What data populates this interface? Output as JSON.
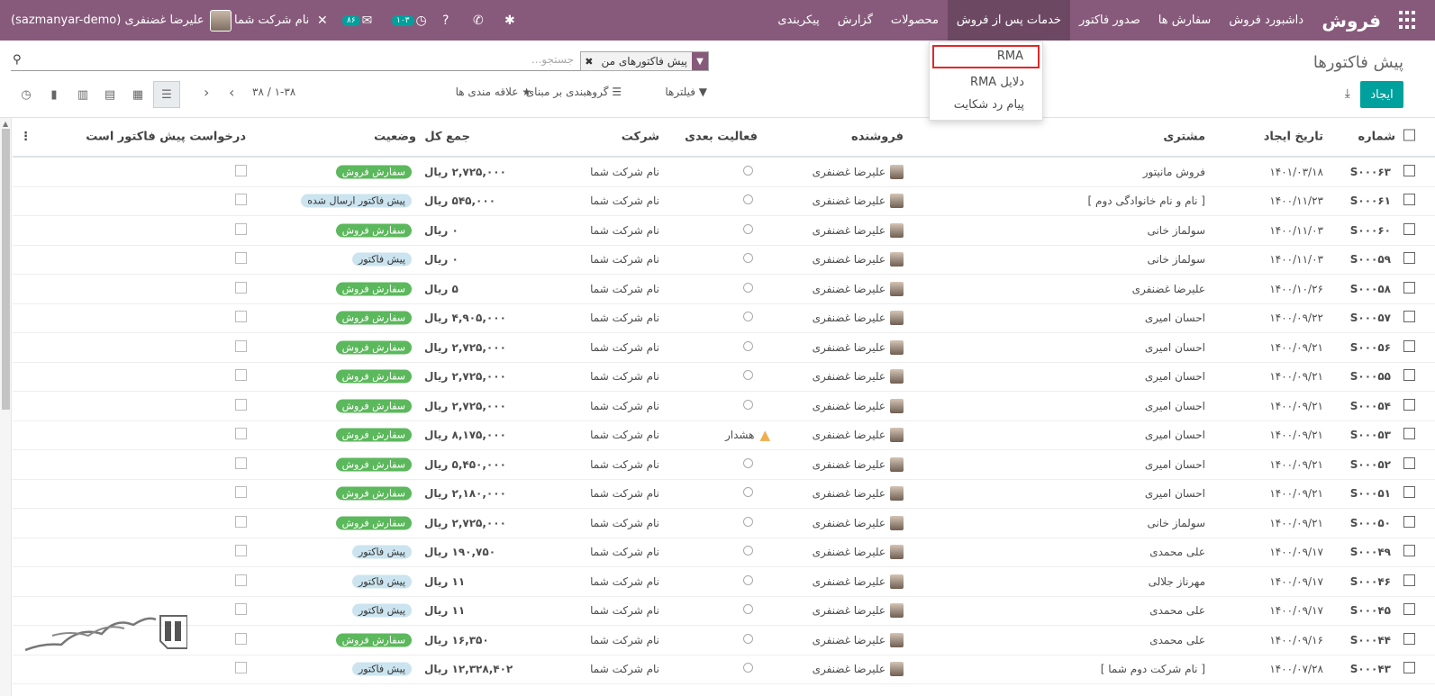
{
  "topbar": {
    "app_title": "فروش",
    "menu": [
      "داشبورد فروش",
      "سفارش ها",
      "صدور فاکتور",
      "خدمات پس از فروش",
      "محصولات",
      "گزارش",
      "پیکربندی"
    ],
    "company": "نام شرکت شما",
    "user": "علیرضا غضنفری (sazmanyar-demo)",
    "badge_activities": "۱۰۳",
    "badge_messages": "۸۶"
  },
  "dropdown": {
    "items": [
      "RMA",
      "دلایل RMA",
      "پیام رد شکایت"
    ]
  },
  "control": {
    "breadcrumb": "پیش فاکتورها",
    "facet": "پیش فاکتورهای من",
    "search_placeholder": "جستجو...",
    "create": "ایجاد",
    "filters": "فیلترها",
    "groupby": "گروهبندی بر مبنای",
    "favorites": "علاقه مندی ها",
    "pager": "۱-۳۸ / ۳۸"
  },
  "colors": {
    "brand": "#875a7b",
    "accent": "#00a09d",
    "sale_order": "#5cb85c",
    "quotation": "#cbe4ef"
  },
  "table": {
    "headers": {
      "number": "شماره",
      "date": "تاریخ ایجاد",
      "customer": "مشتری",
      "salesperson": "فروشنده",
      "activity": "فعالیت بعدی",
      "company": "شرکت",
      "total": "جمع کل",
      "status": "وضعیت",
      "request": "درخواست پیش فاکتور است"
    },
    "rows": [
      {
        "number": "S۰۰۰۶۳",
        "date": "۱۴۰۱/۰۳/۱۸",
        "customer": "فروش مانیتور",
        "salesperson": "علیرضا غضنفری",
        "activity": "",
        "company": "نام شرکت شما",
        "total": "۲,۷۲۵,۰۰۰ ریال",
        "status": "سفارش فروش",
        "status_type": "sale"
      },
      {
        "number": "S۰۰۰۶۱",
        "date": "۱۴۰۰/۱۱/۲۳",
        "customer": "[ نام و نام خانوادگی دوم ]",
        "salesperson": "علیرضا غضنفری",
        "activity": "",
        "company": "نام شرکت شما",
        "total": "۵۴۵,۰۰۰ ریال",
        "status": "پیش فاکتور ارسال شده",
        "status_type": "quote"
      },
      {
        "number": "S۰۰۰۶۰",
        "date": "۱۴۰۰/۱۱/۰۳",
        "customer": "سولماز خانی",
        "salesperson": "علیرضا غضنفری",
        "activity": "",
        "company": "نام شرکت شما",
        "total": "۰ ریال",
        "status": "سفارش فروش",
        "status_type": "sale"
      },
      {
        "number": "S۰۰۰۵۹",
        "date": "۱۴۰۰/۱۱/۰۳",
        "customer": "سولماز خانی",
        "salesperson": "علیرضا غضنفری",
        "activity": "",
        "company": "نام شرکت شما",
        "total": "۰ ریال",
        "status": "پیش فاکتور",
        "status_type": "quote"
      },
      {
        "number": "S۰۰۰۵۸",
        "date": "۱۴۰۰/۱۰/۲۶",
        "customer": "علیرضا غضنفری",
        "salesperson": "علیرضا غضنفری",
        "activity": "",
        "company": "نام شرکت شما",
        "total": "۵ ریال",
        "status": "سفارش فروش",
        "status_type": "sale"
      },
      {
        "number": "S۰۰۰۵۷",
        "date": "۱۴۰۰/۰۹/۲۲",
        "customer": "احسان امیری",
        "salesperson": "علیرضا غضنفری",
        "activity": "",
        "company": "نام شرکت شما",
        "total": "۴,۹۰۵,۰۰۰ ریال",
        "status": "سفارش فروش",
        "status_type": "sale"
      },
      {
        "number": "S۰۰۰۵۶",
        "date": "۱۴۰۰/۰۹/۲۱",
        "customer": "احسان امیری",
        "salesperson": "علیرضا غضنفری",
        "activity": "",
        "company": "نام شرکت شما",
        "total": "۲,۷۲۵,۰۰۰ ریال",
        "status": "سفارش فروش",
        "status_type": "sale"
      },
      {
        "number": "S۰۰۰۵۵",
        "date": "۱۴۰۰/۰۹/۲۱",
        "customer": "احسان امیری",
        "salesperson": "علیرضا غضنفری",
        "activity": "",
        "company": "نام شرکت شما",
        "total": "۲,۷۲۵,۰۰۰ ریال",
        "status": "سفارش فروش",
        "status_type": "sale"
      },
      {
        "number": "S۰۰۰۵۴",
        "date": "۱۴۰۰/۰۹/۲۱",
        "customer": "احسان امیری",
        "salesperson": "علیرضا غضنفری",
        "activity": "",
        "company": "نام شرکت شما",
        "total": "۲,۷۲۵,۰۰۰ ریال",
        "status": "سفارش فروش",
        "status_type": "sale"
      },
      {
        "number": "S۰۰۰۵۳",
        "date": "۱۴۰۰/۰۹/۲۱",
        "customer": "احسان امیری",
        "salesperson": "علیرضا غضنفری",
        "activity": "هشدار",
        "company": "نام شرکت شما",
        "total": "۸,۱۷۵,۰۰۰ ریال",
        "status": "سفارش فروش",
        "status_type": "sale"
      },
      {
        "number": "S۰۰۰۵۲",
        "date": "۱۴۰۰/۰۹/۲۱",
        "customer": "احسان امیری",
        "salesperson": "علیرضا غضنفری",
        "activity": "",
        "company": "نام شرکت شما",
        "total": "۵,۴۵۰,۰۰۰ ریال",
        "status": "سفارش فروش",
        "status_type": "sale"
      },
      {
        "number": "S۰۰۰۵۱",
        "date": "۱۴۰۰/۰۹/۲۱",
        "customer": "احسان امیری",
        "salesperson": "علیرضا غضنفری",
        "activity": "",
        "company": "نام شرکت شما",
        "total": "۲,۱۸۰,۰۰۰ ریال",
        "status": "سفارش فروش",
        "status_type": "sale"
      },
      {
        "number": "S۰۰۰۵۰",
        "date": "۱۴۰۰/۰۹/۲۱",
        "customer": "سولماز خانی",
        "salesperson": "علیرضا غضنفری",
        "activity": "",
        "company": "نام شرکت شما",
        "total": "۲,۷۲۵,۰۰۰ ریال",
        "status": "سفارش فروش",
        "status_type": "sale"
      },
      {
        "number": "S۰۰۰۴۹",
        "date": "۱۴۰۰/۰۹/۱۷",
        "customer": "علی محمدی",
        "salesperson": "علیرضا غضنفری",
        "activity": "",
        "company": "نام شرکت شما",
        "total": "۱۹۰,۷۵۰ ریال",
        "status": "پیش فاکتور",
        "status_type": "quote"
      },
      {
        "number": "S۰۰۰۴۶",
        "date": "۱۴۰۰/۰۹/۱۷",
        "customer": "مهرناز جلالی",
        "salesperson": "علیرضا غضنفری",
        "activity": "",
        "company": "نام شرکت شما",
        "total": "۱۱ ریال",
        "status": "پیش فاکتور",
        "status_type": "quote"
      },
      {
        "number": "S۰۰۰۴۵",
        "date": "۱۴۰۰/۰۹/۱۷",
        "customer": "علی محمدی",
        "salesperson": "علیرضا غضنفری",
        "activity": "",
        "company": "نام شرکت شما",
        "total": "۱۱ ریال",
        "status": "پیش فاکتور",
        "status_type": "quote"
      },
      {
        "number": "S۰۰۰۴۴",
        "date": "۱۴۰۰/۰۹/۱۶",
        "customer": "علی محمدی",
        "salesperson": "علیرضا غضنفری",
        "activity": "",
        "company": "نام شرکت شما",
        "total": "۱۶,۳۵۰ ریال",
        "status": "سفارش فروش",
        "status_type": "sale"
      },
      {
        "number": "S۰۰۰۴۳",
        "date": "۱۴۰۰/۰۷/۲۸",
        "customer": "[ نام شرکت دوم شما ]",
        "salesperson": "علیرضا غضنفری",
        "activity": "",
        "company": "نام شرکت شما",
        "total": "۱۲,۳۲۸,۴۰۲ ریال",
        "status": "پیش فاکتور",
        "status_type": "quote"
      }
    ]
  },
  "watermark": "تسهیلگستر"
}
